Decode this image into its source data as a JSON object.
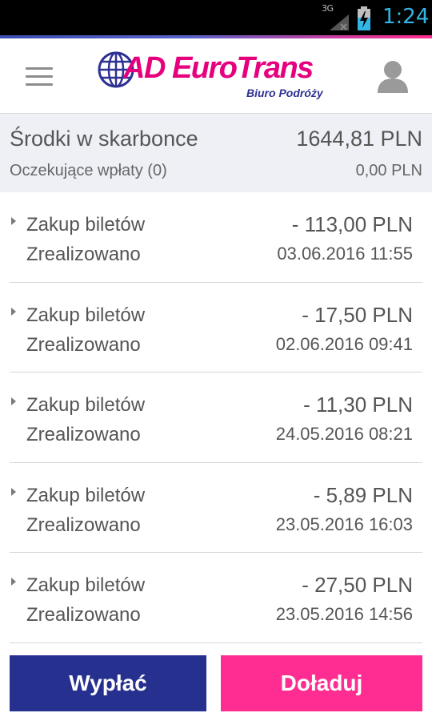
{
  "status_bar": {
    "network": "3G",
    "time": "1:24"
  },
  "header": {
    "logo_main_ad": "AD",
    "logo_main_rest": " EuroTrans",
    "logo_sub": "Biuro Podróży",
    "menu_icon": "hamburger-menu-icon",
    "account_icon": "account-user-icon"
  },
  "balance": {
    "label": "Środki w skarbonce",
    "value": "1644,81 PLN",
    "pending_label": "Oczekujące wpłaty (0)",
    "pending_value": "0,00 PLN"
  },
  "transactions": [
    {
      "title": "Zakup biletów",
      "status": "Zrealizowano",
      "amount": "- 113,00 PLN",
      "date": "03.06.2016 11:55"
    },
    {
      "title": "Zakup biletów",
      "status": "Zrealizowano",
      "amount": "- 17,50 PLN",
      "date": "02.06.2016 09:41"
    },
    {
      "title": "Zakup biletów",
      "status": "Zrealizowano",
      "amount": "- 11,30 PLN",
      "date": "24.05.2016 08:21"
    },
    {
      "title": "Zakup biletów",
      "status": "Zrealizowano",
      "amount": "- 5,89 PLN",
      "date": "23.05.2016 16:03"
    },
    {
      "title": "Zakup biletów",
      "status": "Zrealizowano",
      "amount": "- 27,50 PLN",
      "date": "23.05.2016 14:56"
    }
  ],
  "actions": {
    "withdraw_label": "Wypłać",
    "topup_label": "Doładuj"
  },
  "colors": {
    "brand_pink": "#e6007e",
    "brand_blue": "#2e3192",
    "withdraw_button": "#26308f",
    "topup_button": "#ff2d91",
    "status_time": "#33b5e5"
  }
}
